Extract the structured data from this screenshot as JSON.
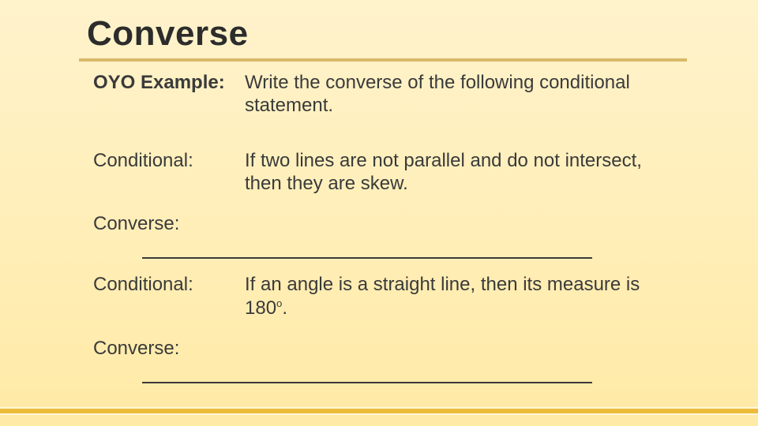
{
  "title": "Converse",
  "example_label": "OYO Example:",
  "example_text": "Write the converse of the following conditional statement.",
  "items": [
    {
      "cond_label": "Conditional:",
      "cond_text_before": "If two lines are not parallel and do not intersect, then they are skew.",
      "conv_label": "Converse:"
    },
    {
      "cond_label": "Conditional:",
      "cond_text_before": "If an angle is a straight line, then its measure is 180",
      "sup": "o",
      "cond_text_after": ".",
      "conv_label": "Converse:"
    }
  ]
}
